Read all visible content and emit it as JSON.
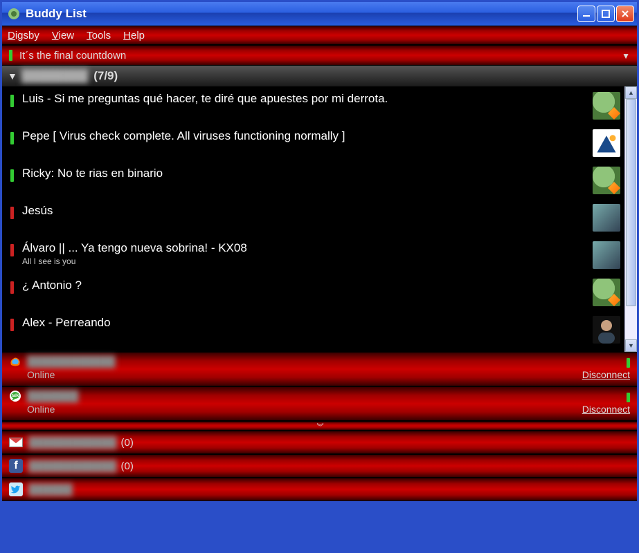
{
  "window": {
    "title": "Buddy List"
  },
  "menu": {
    "items": [
      {
        "label": "Digsby",
        "accel": "D"
      },
      {
        "label": "View",
        "accel": "V"
      },
      {
        "label": "Tools",
        "accel": "T"
      },
      {
        "label": "Help",
        "accel": "H"
      }
    ]
  },
  "status": {
    "text": "It´s the final countdown",
    "presence": "online"
  },
  "group": {
    "name": "████████",
    "count": "(7/9)"
  },
  "buddies": [
    {
      "presence": "online",
      "text": "Luis - Si me preguntas qué hacer, te diré que apuestes por mi derrota.",
      "sub": "",
      "avatar": "digsby"
    },
    {
      "presence": "online",
      "text": "Pepe [ Virus check complete. All viruses functioning normally ]",
      "sub": "",
      "avatar": "generic"
    },
    {
      "presence": "online",
      "text": "Ricky: No te rias en binario",
      "sub": "",
      "avatar": "digsby"
    },
    {
      "presence": "away",
      "text": "Jesús",
      "sub": "",
      "avatar": "photo"
    },
    {
      "presence": "away",
      "text": "Álvaro || ... Ya tengo nueva sobrina!  - KX08",
      "sub": "All I see is you",
      "avatar": "photo"
    },
    {
      "presence": "away",
      "text": "¿ Antonio ?",
      "sub": "",
      "avatar": "digsby"
    },
    {
      "presence": "away",
      "text": "Alex - Perreando",
      "sub": "",
      "avatar": "person"
    }
  ],
  "accounts": [
    {
      "service": "msn",
      "name": "████████████",
      "status": "Online",
      "action": "Disconnect"
    },
    {
      "service": "gtalk",
      "name": "███████",
      "status": "Online",
      "action": "Disconnect"
    }
  ],
  "socials": [
    {
      "service": "gmail",
      "name": "████████████",
      "count": "(0)"
    },
    {
      "service": "facebook",
      "name": "████████████",
      "count": "(0)"
    },
    {
      "service": "twitter",
      "name": "██████",
      "count": ""
    }
  ]
}
